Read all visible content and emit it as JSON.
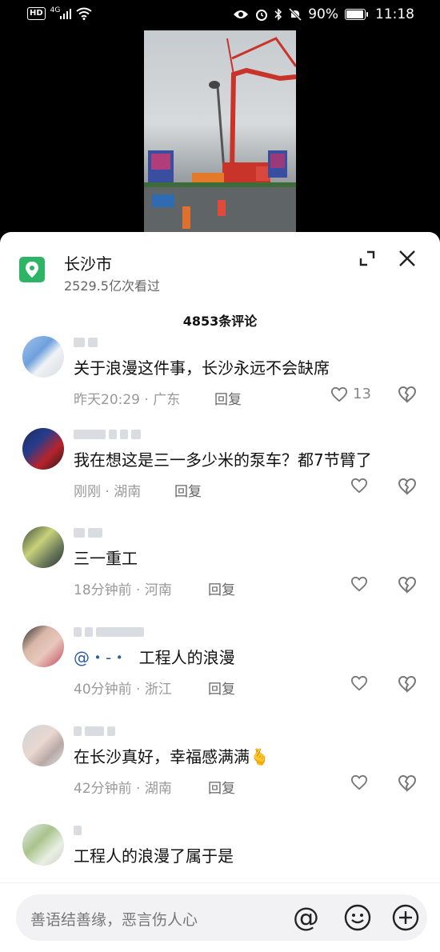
{
  "status_bar": {
    "hd": "HD",
    "network": "4G",
    "battery_pct": "90%",
    "time": "11:18"
  },
  "location": {
    "title": "长沙市",
    "views": "2529.5亿次看过"
  },
  "comment_count": "4853条评论",
  "comments": [
    {
      "text": "关于浪漫这件事，长沙永远不会缺席",
      "time": "昨天20:29",
      "region": "广东",
      "reply": "回复",
      "likes": "13"
    },
    {
      "text": "我在想这是三一多少米的泵车？都7节臂了",
      "time": "刚刚",
      "region": "湖南",
      "reply": "回复",
      "likes": ""
    },
    {
      "text": "三一重工",
      "time": "18分钟前",
      "region": "河南",
      "reply": "回复",
      "likes": ""
    },
    {
      "mention": "@・-・",
      "text": "工程人的浪漫",
      "time": "40分钟前",
      "region": "浙江",
      "reply": "回复",
      "likes": ""
    },
    {
      "text": "在长沙真好，幸福感满满🫰",
      "time": "42分钟前",
      "region": "湖南",
      "reply": "回复",
      "likes": ""
    },
    {
      "text": "工程人的浪漫了属于是",
      "time": "",
      "region": "",
      "reply": "",
      "likes": ""
    }
  ],
  "input": {
    "placeholder": "善语结善缘，恶言伤人心",
    "at_symbol": "@"
  },
  "colors": {
    "accent_green": "#2db464",
    "mention_blue": "#2f5c9f"
  },
  "icons": [
    "location-pin-icon",
    "expand-icon",
    "close-icon",
    "heart-icon",
    "broken-heart-icon",
    "at-icon",
    "emoji-icon",
    "plus-icon"
  ]
}
